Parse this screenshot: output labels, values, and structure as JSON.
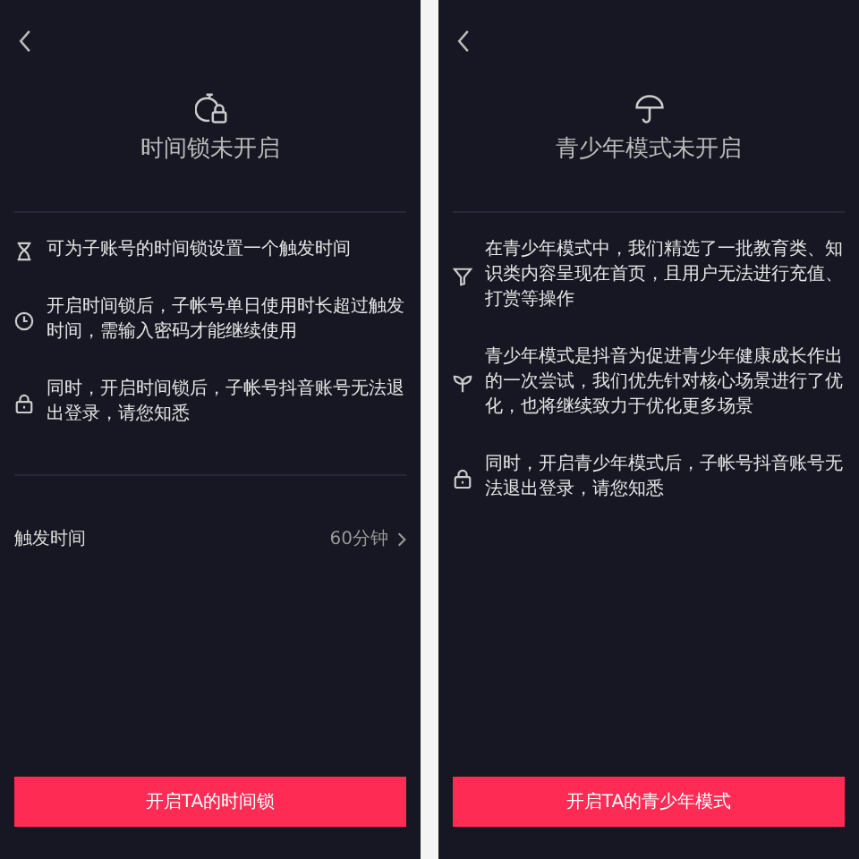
{
  "panels": [
    {
      "kind": "timer-lock",
      "title": "时间锁未开启",
      "items": [
        {
          "kind": "hourglass",
          "text": "可为子账号的时间锁设置一个触发时间"
        },
        {
          "kind": "clock",
          "text": "开启时间锁后，子帐号单日使用时长超过触发时间，需输入密码才能继续使用"
        },
        {
          "kind": "lock",
          "text": "同时，开启时间锁后，子帐号抖音账号无法退出登录，请您知悉"
        }
      ],
      "setting": {
        "label": "触发时间",
        "value": "60分钟"
      },
      "button": "开启TA的时间锁"
    },
    {
      "kind": "umbrella",
      "title": "青少年模式未开启",
      "items": [
        {
          "kind": "filter",
          "text": "在青少年模式中，我们精选了一批教育类、知识类内容呈现在首页，且用户无法进行充值、打赏等操作"
        },
        {
          "kind": "sprout",
          "text": "青少年模式是抖音为促进青少年健康成长作出的一次尝试，我们优先针对核心场景进行了优化，也将继续致力于优化更多场景"
        },
        {
          "kind": "lock",
          "text": "同时，开启青少年模式后，子帐号抖音账号无法退出登录，请您知悉"
        }
      ],
      "button": "开启TA的青少年模式"
    }
  ]
}
